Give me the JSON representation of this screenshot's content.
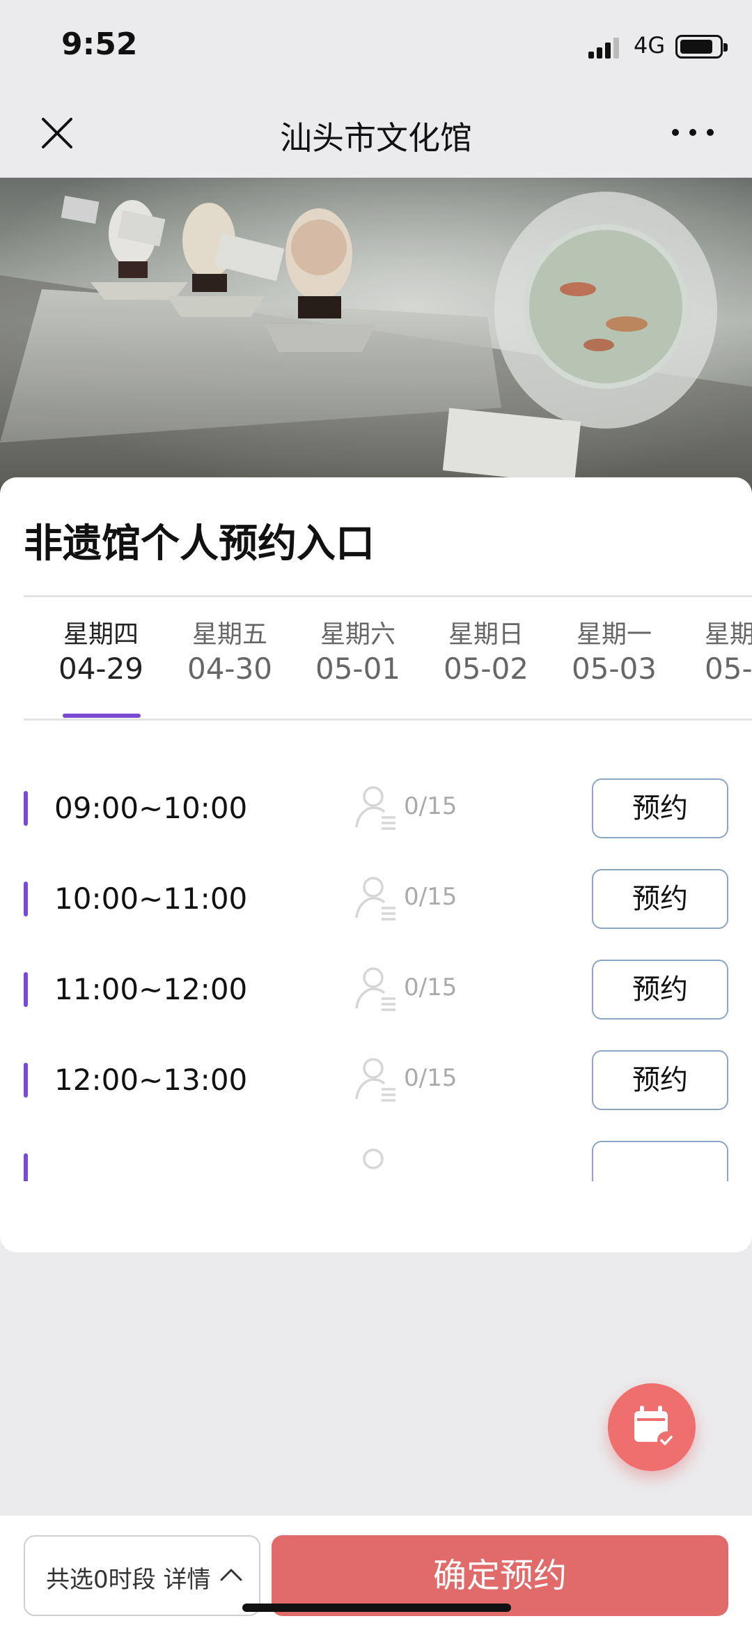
{
  "status_bar": {
    "time": "9:52",
    "network": "4G"
  },
  "nav": {
    "title": "汕头市文化馆"
  },
  "card": {
    "title": "非遗馆个人预约入口",
    "tabs": [
      {
        "weekday": "星期四",
        "date": "04-29",
        "active": true
      },
      {
        "weekday": "星期五",
        "date": "04-30",
        "active": false
      },
      {
        "weekday": "星期六",
        "date": "05-01",
        "active": false
      },
      {
        "weekday": "星期日",
        "date": "05-02",
        "active": false
      },
      {
        "weekday": "星期一",
        "date": "05-03",
        "active": false
      },
      {
        "weekday": "星期",
        "date": "05-0",
        "active": false
      }
    ],
    "slots": [
      {
        "time": "09:00~10:00",
        "count": "0/15",
        "button": "预约"
      },
      {
        "time": "10:00~11:00",
        "count": "0/15",
        "button": "预约"
      },
      {
        "time": "11:00~12:00",
        "count": "0/15",
        "button": "预约"
      },
      {
        "time": "12:00~13:00",
        "count": "0/15",
        "button": "预约"
      }
    ]
  },
  "bottom": {
    "summary": "共选0时段 详情",
    "confirm": "确定预约"
  },
  "colors": {
    "accent": "#7a4ad3",
    "confirm_bg": "#e16a6a",
    "fab_bg": "#ef6e6e",
    "button_border": "#8da4c6"
  },
  "icons": {
    "close": "close-icon",
    "more": "more-icon",
    "user": "user-list-icon",
    "calendar": "calendar-check-icon",
    "chevron": "chevron-up-icon"
  }
}
